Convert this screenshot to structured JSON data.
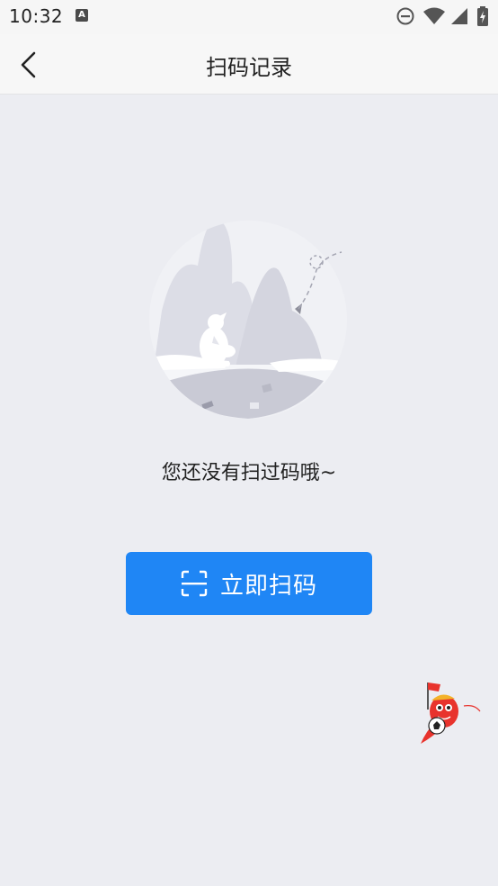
{
  "status_bar": {
    "time": "10:32",
    "notification_icon": "A",
    "icons": [
      "do-not-disturb-icon",
      "wifi-icon",
      "signal-icon",
      "battery-charging-icon"
    ]
  },
  "header": {
    "title": "扫码记录",
    "back_icon": "chevron-left-icon"
  },
  "empty_state": {
    "message": "您还没有扫过码哦~",
    "illustration": "polar-bear-iceberg-illustration"
  },
  "scan_button": {
    "label": "立即扫码",
    "icon": "scan-frame-icon"
  },
  "floating": {
    "mascot_icon": "soccer-mascot-icon"
  },
  "colors": {
    "accent": "#1f86f5",
    "background": "#ecedf2",
    "header_bg": "#f7f7f7"
  }
}
